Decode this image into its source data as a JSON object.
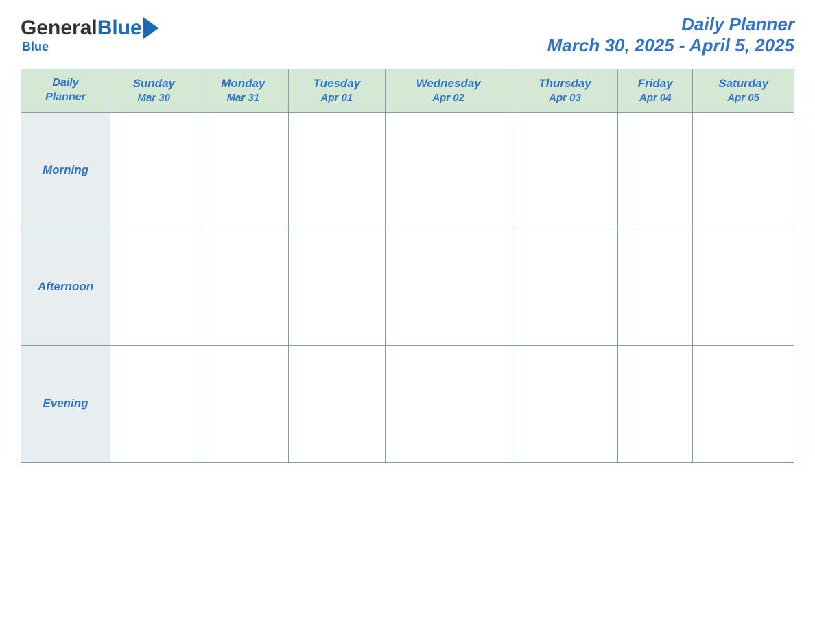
{
  "header": {
    "logo": {
      "general_text": "General",
      "blue_text": "Blue"
    },
    "title": "Daily Planner",
    "date_range": "March 30, 2025 - April 5, 2025"
  },
  "table": {
    "header_col": {
      "line1": "Daily",
      "line2": "Planner"
    },
    "days": [
      {
        "name": "Sunday",
        "date": "Mar 30"
      },
      {
        "name": "Monday",
        "date": "Mar 31"
      },
      {
        "name": "Tuesday",
        "date": "Apr 01"
      },
      {
        "name": "Wednesday",
        "date": "Apr 02"
      },
      {
        "name": "Thursday",
        "date": "Apr 03"
      },
      {
        "name": "Friday",
        "date": "Apr 04"
      },
      {
        "name": "Saturday",
        "date": "Apr 05"
      }
    ],
    "rows": [
      {
        "label": "Morning"
      },
      {
        "label": "Afternoon"
      },
      {
        "label": "Evening"
      }
    ]
  }
}
